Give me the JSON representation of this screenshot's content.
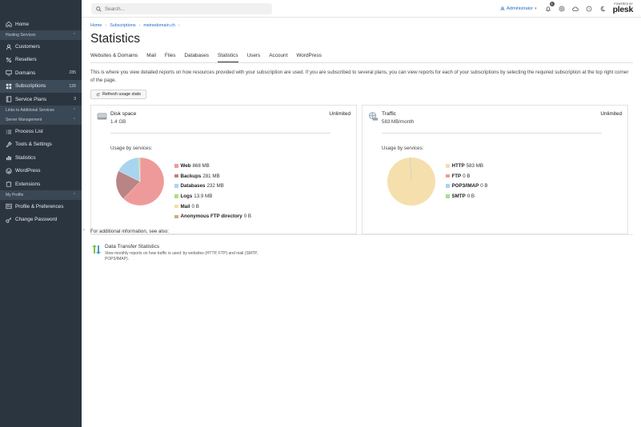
{
  "header": {
    "search_placeholder": "Search...",
    "admin_label": "Administrator",
    "notif_count": "1",
    "logo_powered": "POWERED BY",
    "logo_name": "plesk"
  },
  "sidebar": {
    "items": [
      {
        "type": "item",
        "label": "Home",
        "icon": "home-icon"
      },
      {
        "type": "section",
        "label": "Hosting Services"
      },
      {
        "type": "item",
        "label": "Customers",
        "icon": "user-icon"
      },
      {
        "type": "item",
        "label": "Resellers",
        "icon": "percent-icon"
      },
      {
        "type": "item",
        "label": "Domains",
        "icon": "monitor-icon",
        "count": "285"
      },
      {
        "type": "item",
        "label": "Subscriptions",
        "icon": "grid-icon",
        "count": "126",
        "active": true
      },
      {
        "type": "item",
        "label": "Service Plans",
        "icon": "book-icon",
        "count": "3"
      },
      {
        "type": "section",
        "label": "Links to Additional Services"
      },
      {
        "type": "section",
        "label": "Server Management"
      },
      {
        "type": "item",
        "label": "Process List",
        "icon": "list-icon"
      },
      {
        "type": "item",
        "label": "Tools & Settings",
        "icon": "wrench-icon"
      },
      {
        "type": "item",
        "label": "Statistics",
        "icon": "chart-icon"
      },
      {
        "type": "item",
        "label": "WordPress",
        "icon": "wordpress-icon"
      },
      {
        "type": "item",
        "label": "Extensions",
        "icon": "puzzle-icon"
      },
      {
        "type": "section",
        "label": "My Profile"
      },
      {
        "type": "item",
        "label": "Profile & Preferences",
        "icon": "profile-icon"
      },
      {
        "type": "item",
        "label": "Change Password",
        "icon": "key-icon"
      }
    ]
  },
  "breadcrumb": [
    "Home",
    "Subscriptions",
    "meinedomain.ch"
  ],
  "page_title": "Statistics",
  "tabs": [
    {
      "label": "Websites & Domains"
    },
    {
      "label": "Mail"
    },
    {
      "label": "Files"
    },
    {
      "label": "Databases"
    },
    {
      "label": "Statistics",
      "active": true
    },
    {
      "label": "Users"
    },
    {
      "label": "Account"
    },
    {
      "label": "WordPress"
    }
  ],
  "description": "This is where you view detailed reports on how resources provided with your subscription are used. If you are subscribed to several plans, you can view reports for each of your subscriptions by selecting the required subscription at the top right corner of the page.",
  "refresh_label": "Refresh usage stats",
  "disk": {
    "name": "Disk space",
    "value": "1.4 GB",
    "limit": "Unlimited",
    "usage_label": "Usage by services:",
    "services": [
      {
        "name": "Web",
        "value": "868 MB",
        "mb": 868,
        "color": "#ef9a9a"
      },
      {
        "name": "Backups",
        "value": "281 MB",
        "mb": 281,
        "color": "#b98484"
      },
      {
        "name": "Databases",
        "value": "232 MB",
        "mb": 232,
        "color": "#a9d4ef"
      },
      {
        "name": "Logs",
        "value": "13.9 MB",
        "mb": 13.9,
        "color": "#a8e08a"
      },
      {
        "name": "Mail",
        "value": "0 B",
        "mb": 0,
        "color": "#f5df9d"
      },
      {
        "name": "Anonymous FTP directory",
        "value": "0 B",
        "mb": 0,
        "color": "#c9ae7a"
      }
    ]
  },
  "traffic": {
    "name": "Traffic",
    "value": "583 MB/month",
    "limit": "Unlimited",
    "usage_label": "Usage by services:",
    "services": [
      {
        "name": "HTTP",
        "value": "583 MB",
        "mb": 583,
        "color": "#f5dfad"
      },
      {
        "name": "FTP",
        "value": "0 B",
        "mb": 0,
        "color": "#ef9a9a"
      },
      {
        "name": "POP3/IMAP",
        "value": "0 B",
        "mb": 0,
        "color": "#a9d4ef"
      },
      {
        "name": "SMTP",
        "value": "0 B",
        "mb": 0,
        "color": "#a8e08a"
      }
    ]
  },
  "see_also": "For additional information, see also:",
  "dts": {
    "title": "Data Transfer Statistics",
    "desc": "View monthly reports on how traffic is used: by websites (HTTP, FTP) and mail (SMTP, POP3/IMAP)."
  }
}
